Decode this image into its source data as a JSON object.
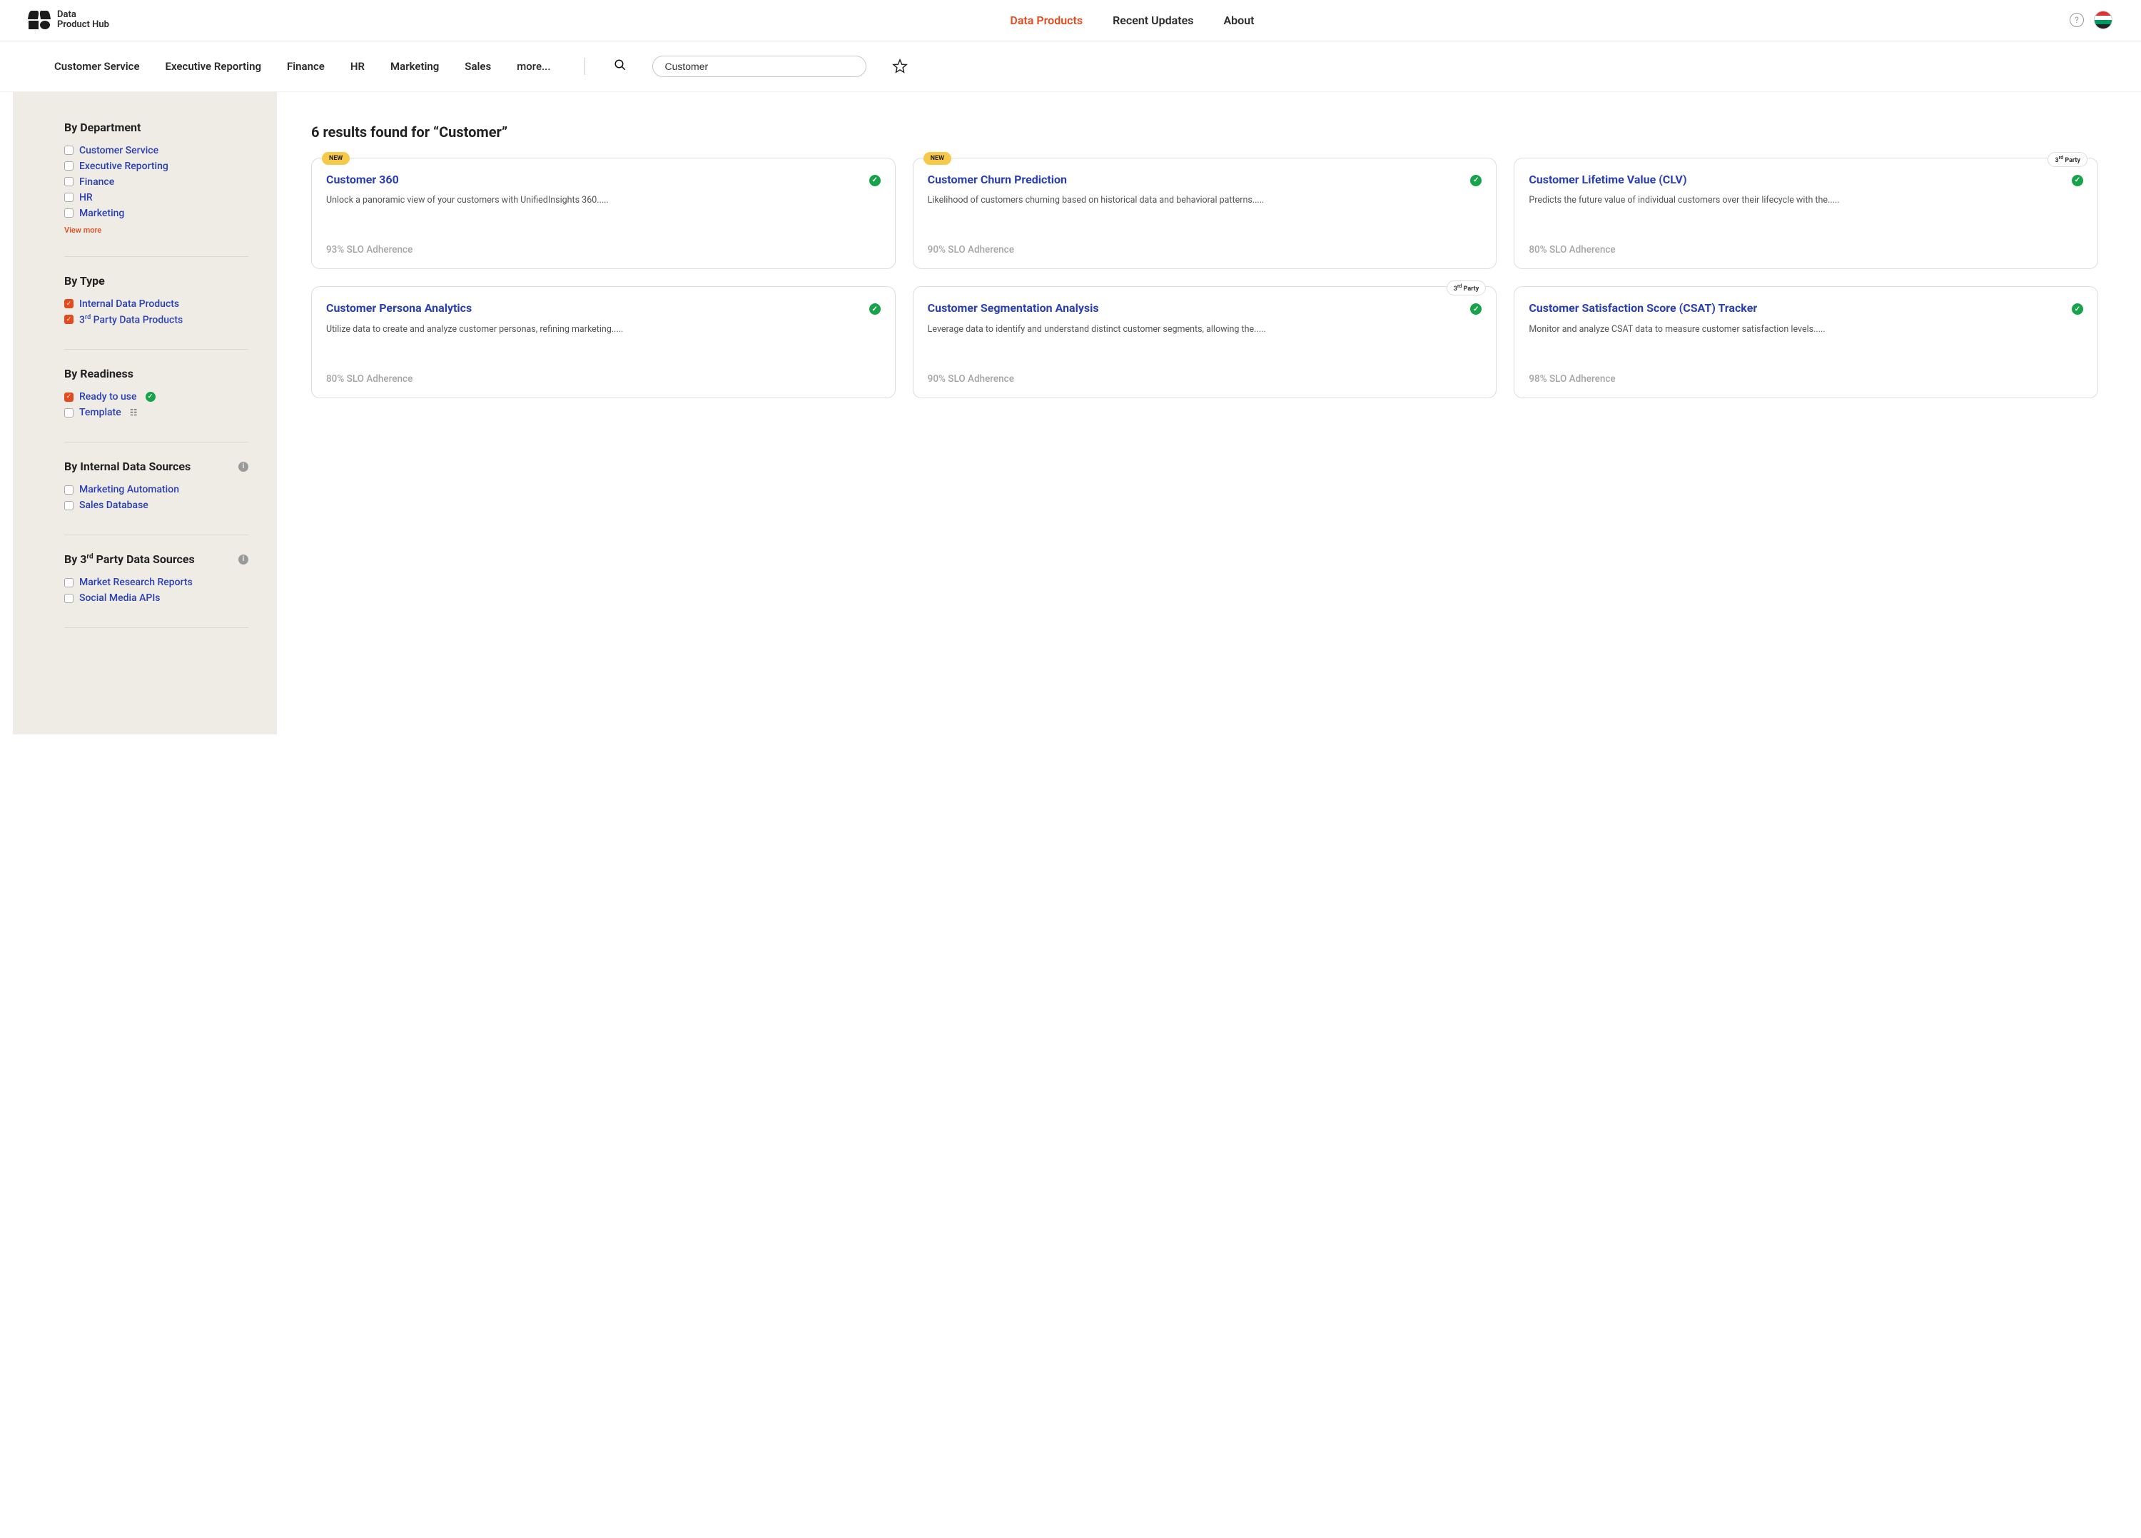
{
  "brand": {
    "line1": "Data",
    "line2": "Product Hub"
  },
  "nav": {
    "items": [
      "Data Products",
      "Recent Updates",
      "About"
    ],
    "active_index": 0
  },
  "subnav": {
    "items": [
      "Customer Service",
      "Executive Reporting",
      "Finance",
      "HR",
      "Marketing",
      "Sales"
    ],
    "more_label": "more...",
    "search_value": "Customer"
  },
  "results_title": "6 results found for “Customer”",
  "sidebar": {
    "department": {
      "heading": "By Department",
      "items": [
        "Customer Service",
        "Executive Reporting",
        "Finance",
        "HR",
        "Marketing"
      ],
      "view_more": "View more"
    },
    "type": {
      "heading": "By Type",
      "items": [
        {
          "label": "Internal Data Products",
          "checked": true
        },
        {
          "label_html": "3<sup>rd</sup> Party Data Products",
          "checked": true
        }
      ]
    },
    "readiness": {
      "heading": "By Readiness",
      "items": [
        {
          "label": "Ready to use",
          "checked": true,
          "suffix": "check"
        },
        {
          "label": "Template",
          "checked": false,
          "suffix": "list"
        }
      ]
    },
    "internal_sources": {
      "heading": "By Internal Data Sources",
      "items": [
        "Marketing Automation",
        "Sales Database"
      ]
    },
    "third_party_sources": {
      "heading_html": "By 3<sup>rd</sup> Party Data Sources",
      "items": [
        "Market Research Reports",
        "Social Media APIs"
      ]
    }
  },
  "cards": [
    {
      "title": "Customer 360",
      "badge": "NEW",
      "desc": "Unlock a panoramic view of your customers with UnifiedInsights 360.....",
      "slo": "93% SLO Adherence"
    },
    {
      "title": "Customer Churn Prediction",
      "badge": "NEW",
      "desc": "Likelihood of customers churning based on historical data and behavioral patterns.....",
      "slo": "90% SLO Adherence"
    },
    {
      "title": "Customer Lifetime Value (CLV)",
      "badge": "3rd Party",
      "desc": "Predicts the future value of individual customers over their lifecycle with the.....",
      "slo": "80% SLO Adherence"
    },
    {
      "title": "Customer Persona Analytics",
      "badge": null,
      "desc": "Utilize data to create and analyze customer personas, refining marketing.....",
      "slo": "80% SLO Adherence"
    },
    {
      "title": "Customer Segmentation Analysis",
      "badge": "3rd Party",
      "desc": "Leverage data to identify and understand distinct customer segments, allowing the.....",
      "slo": "90% SLO Adherence"
    },
    {
      "title": "Customer Satisfaction Score (CSAT) Tracker",
      "badge": null,
      "desc": "Monitor and analyze CSAT data to measure customer satisfaction levels.....",
      "slo": "98% SLO Adherence"
    }
  ]
}
